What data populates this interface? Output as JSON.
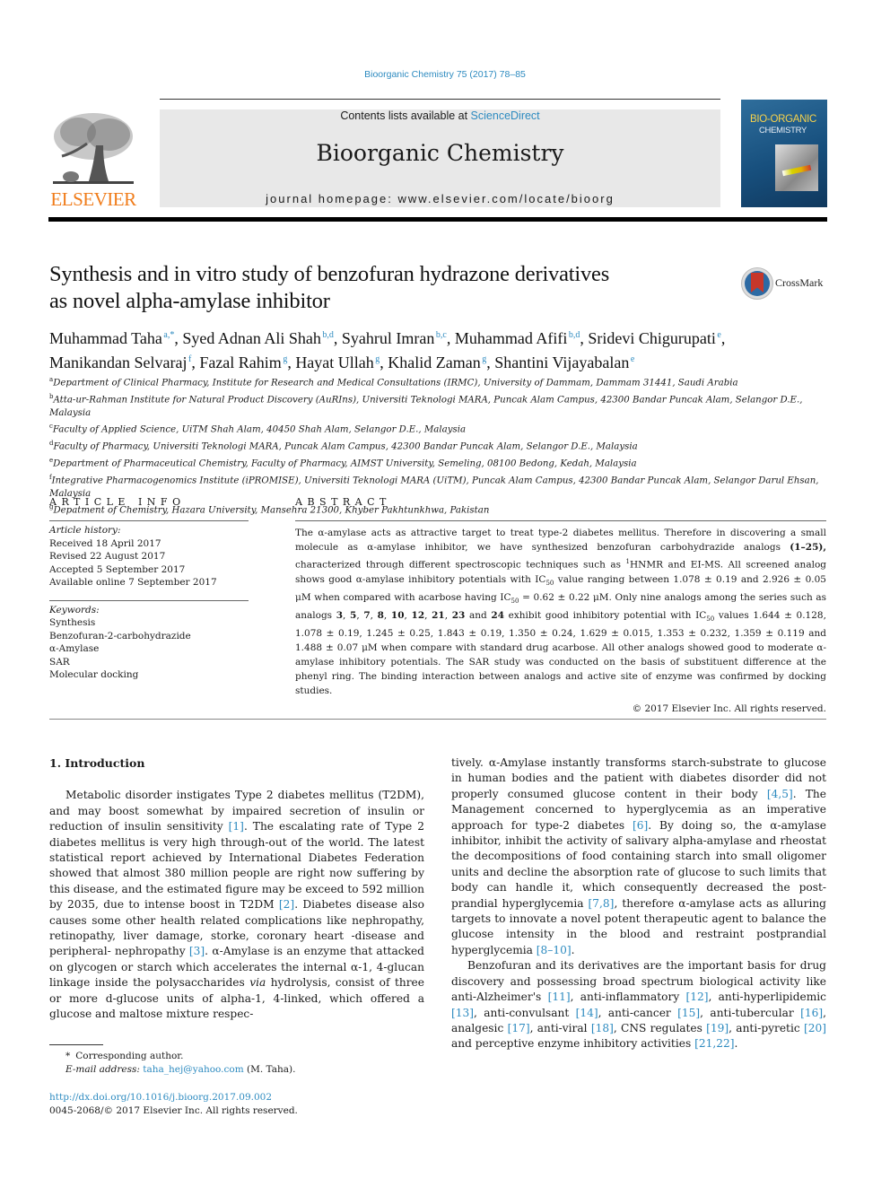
{
  "header": {
    "citation": "Bioorganic Chemistry 75 (2017) 78–85",
    "contents_prefix": "Contents lists available at ",
    "contents_link": "ScienceDirect",
    "journal_title": "Bioorganic Chemistry",
    "homepage": "journal homepage: www.elsevier.com/locate/bioorg",
    "publisher_logo": "ELSEVIER",
    "cover_title_1": "BIO-ORGANIC",
    "cover_title_2": "CHEMISTRY"
  },
  "article": {
    "title_line1": "Synthesis and in vitro study of benzofuran hydrazone derivatives",
    "title_line2": "as novel alpha-amylase inhibitor",
    "crossmark": "CrossMark",
    "authors": [
      {
        "name": "Muhammad Taha",
        "sup": "a,*"
      },
      {
        "name": "Syed Adnan Ali Shah",
        "sup": "b,d"
      },
      {
        "name": "Syahrul Imran",
        "sup": "b,c"
      },
      {
        "name": "Muhammad Afifi",
        "sup": "b,d"
      },
      {
        "name": "Sridevi Chigurupati",
        "sup": "e"
      },
      {
        "name": "Manikandan Selvaraj",
        "sup": "f"
      },
      {
        "name": "Fazal Rahim",
        "sup": "g"
      },
      {
        "name": "Hayat Ullah",
        "sup": "g"
      },
      {
        "name": "Khalid Zaman",
        "sup": "g"
      },
      {
        "name": "Shantini Vijayabalan",
        "sup": "e"
      }
    ],
    "affiliations": [
      {
        "key": "a",
        "text": "Department of Clinical Pharmacy, Institute for Research and Medical Consultations (IRMC), University of Dammam, Dammam 31441, Saudi Arabia"
      },
      {
        "key": "b",
        "text": "Atta-ur-Rahman Institute for Natural Product Discovery (AuRIns), Universiti Teknologi MARA, Puncak Alam Campus, 42300 Bandar Puncak Alam, Selangor D.E., Malaysia"
      },
      {
        "key": "c",
        "text": "Faculty of Applied Science, UiTM Shah Alam, 40450 Shah Alam, Selangor D.E., Malaysia"
      },
      {
        "key": "d",
        "text": "Faculty of Pharmacy, Universiti Teknologi MARA, Puncak Alam Campus, 42300 Bandar Puncak Alam, Selangor D.E., Malaysia"
      },
      {
        "key": "e",
        "text": "Department of Pharmaceutical Chemistry, Faculty of Pharmacy, AIMST University, Semeling, 08100 Bedong, Kedah, Malaysia"
      },
      {
        "key": "f",
        "text": "Integrative Pharmacogenomics Institute (iPROMISE), Universiti Teknologi MARA (UiTM), Puncak Alam Campus, 42300 Bandar Puncak Alam, Selangor Darul Ehsan, Malaysia"
      },
      {
        "key": "g",
        "text": "Depatment of Chemistry, Hazara University, Mansehra 21300, Khyber Pakhtunkhwa, Pakistan"
      }
    ]
  },
  "article_info": {
    "heading": "ARTICLE INFO",
    "history_label": "Article history:",
    "history": [
      "Received 18 April 2017",
      "Revised 22 August 2017",
      "Accepted 5 September 2017",
      "Available online 7 September 2017"
    ],
    "keywords_label": "Keywords:",
    "keywords": [
      "Synthesis",
      "Benzofuran-2-carbohydrazide",
      "α-Amylase",
      "SAR",
      "Molecular docking"
    ]
  },
  "abstract": {
    "heading": "ABSTRACT",
    "p1": "The α-amylase acts as attractive target to treat type-2 diabetes mellitus. Therefore in discovering a small molecule as α-amylase inhibitor, we have synthesized benzofuran carbohydrazide analogs ",
    "p1_bold": "(1–25),",
    "p2": " characterized through different spectroscopic techniques such as ",
    "p2_sup": "1",
    "p3": "HNMR and EI-MS. All screened analog shows good α-amylase inhibitory potentials with IC",
    "sub50": "50",
    "p4": " value ranging between 1.078 ± 0.19 and 2.926 ± 0.05 μM when compared with acarbose having IC",
    "p5": " = 0.62 ± 0.22 μM. Only nine analogs among the series such as analogs ",
    "analogs": [
      "3",
      "5",
      "7",
      "8",
      "10",
      "12",
      "21",
      "23",
      "24"
    ],
    "p6": " exhibit good inhibitory potential with IC",
    "p7": " values 1.644 ± 0.128, 1.078 ± 0.19, 1.245 ± 0.25, 1.843 ± 0.19, 1.350 ± 0.24, 1.629 ± 0.015, 1.353 ± 0.232, 1.359 ± 0.119 and 1.488 ± 0.07 μM when compare with standard drug acarbose. All other analogs showed good to moderate α-amylase inhibitory potentials. The SAR study was conducted on the basis of substituent difference at the phenyl ring. The binding interaction between analogs and active site of enzyme was confirmed by docking studies.",
    "copyright": "© 2017 Elsevier Inc. All rights reserved."
  },
  "body": {
    "intro_heading": "1. Introduction",
    "c1_a": "Metabolic disorder instigates Type 2 diabetes mellitus (T2DM), and may boost somewhat by impaired secretion of insulin or reduction of insulin sensitivity ",
    "ref1": "[1]",
    "c1_b": ". The escalating rate of Type 2 diabetes mellitus is very high through-out of the world. The latest statistical report achieved by International Diabetes Federation showed that almost 380 million people are right now suffering by this disease, and the estimated figure may be exceed to 592 million by 2035, due to intense boost in T2DM ",
    "ref2": "[2]",
    "c1_c": ". Diabetes disease also causes some other health related complications like nephropathy, retinopathy, liver damage, storke, coronary heart -disease and peripheral- nephropathy ",
    "ref3": "[3]",
    "c1_d": ". α-Amylase is an enzyme that attacked on glycogen or starch which accelerates the internal α-1, 4-glucan linkage inside the polysaccharides ",
    "c1_via": "via",
    "c1_e": " hydrolysis, consist of three or more d-glucose units of alpha-1, 4-linked, which offered a glucose and maltose mixture respec-",
    "c2_a": "tively. α-Amylase instantly transforms starch-substrate to glucose in human bodies and the patient with diabetes disorder did not properly consumed glucose content in their body ",
    "ref45": "[4,5]",
    "c2_b": ". The Management concerned to hyperglycemia as an imperative approach for type-2 diabetes ",
    "ref6": "[6]",
    "c2_c": ". By doing so, the α-amylase inhibitor, inhibit the activity of salivary alpha-amylase and rheostat the decompositions of food containing starch into small oligomer units and decline the absorption rate of glucose to such limits that body can handle it, which consequently decreased the post-prandial hyperglycemia ",
    "ref78": "[7,8]",
    "c2_d": ", therefore α-amylase acts as alluring targets to innovate a novel potent therapeutic agent to balance the glucose intensity in the blood and restraint postprandial hyperglycemia ",
    "ref810": "[8–10]",
    "c2_e": ".",
    "p2_a": "Benzofuran and its derivatives are the important basis for drug discovery and possessing broad spectrum biological activity like anti-Alzheimer's ",
    "ref11": "[11]",
    "p2_b": ", anti-inflammatory ",
    "ref12": "[12]",
    "p2_c": ", anti-hyperlipidemic ",
    "ref13": "[13]",
    "p2_d": ", anti-convulsant ",
    "ref14": "[14]",
    "p2_e": ", anti-cancer ",
    "ref15": "[15]",
    "p2_f": ", anti-tubercular ",
    "ref16": "[16]",
    "p2_g": ", analgesic ",
    "ref17": "[17]",
    "p2_h": ", anti-viral ",
    "ref18": "[18]",
    "p2_i": ", CNS regulates ",
    "ref19": "[19]",
    "p2_j": ", anti-pyretic ",
    "ref20": "[20]",
    "p2_k": " and perceptive enzyme inhibitory activities ",
    "ref2122": "[21,22]",
    "p2_l": "."
  },
  "footnote": {
    "star": "*",
    "corresponding": "Corresponding author.",
    "email_label": "E-mail address:",
    "email": "taha_hej@yahoo.com",
    "email_suffix": " (M. Taha).",
    "doi": "http://dx.doi.org/10.1016/j.bioorg.2017.09.002",
    "issn": "0045-2068/© 2017 Elsevier Inc. All rights reserved."
  },
  "colors": {
    "link": "#2e8bc0",
    "elsevier_orange": "#f07c1a"
  }
}
